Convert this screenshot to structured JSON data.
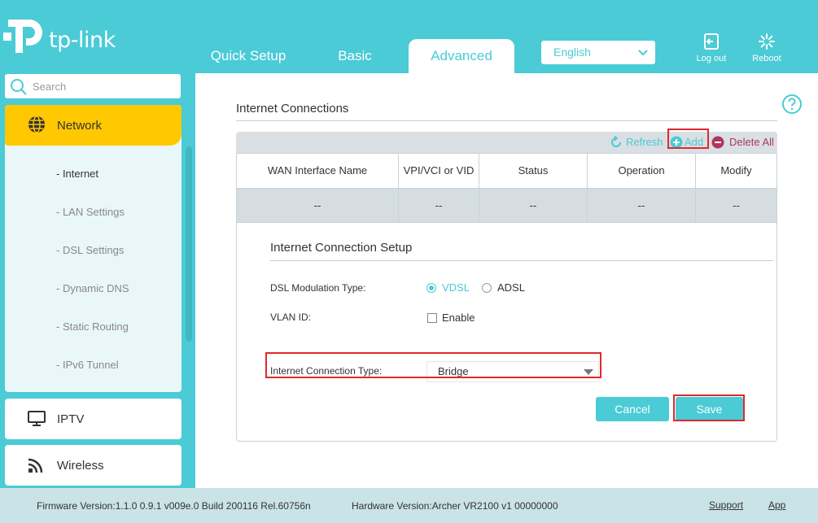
{
  "header": {
    "logo_text": "tp-link",
    "tabs": [
      {
        "label": "Quick Setup",
        "active": false
      },
      {
        "label": "Basic",
        "active": false
      },
      {
        "label": "Advanced",
        "active": true
      }
    ],
    "language": "English",
    "logout_label": "Log out",
    "reboot_label": "Reboot"
  },
  "sidebar": {
    "search_placeholder": "Search",
    "active_menu": {
      "label": "Network",
      "icon": "globe-icon"
    },
    "submenu": [
      {
        "label": "- Internet",
        "active": true
      },
      {
        "label": "- LAN Settings",
        "active": false
      },
      {
        "label": "- DSL Settings",
        "active": false
      },
      {
        "label": "- Dynamic DNS",
        "active": false
      },
      {
        "label": "- Static Routing",
        "active": false
      },
      {
        "label": "- IPv6 Tunnel",
        "active": false
      }
    ],
    "menu_items": [
      {
        "label": "IPTV",
        "icon": "monitor-icon"
      },
      {
        "label": "Wireless",
        "icon": "wifi-icon"
      }
    ]
  },
  "main": {
    "section_title": "Internet Connections",
    "toolbar": {
      "refresh": "Refresh",
      "add": "Add",
      "delete_all": "Delete All"
    },
    "table": {
      "headers": [
        "WAN Interface Name",
        "VPI/VCI or VID",
        "Status",
        "Operation",
        "Modify"
      ],
      "rows": [
        [
          "--",
          "--",
          "--",
          "--",
          "--"
        ]
      ]
    },
    "setup": {
      "title": "Internet Connection Setup",
      "dsl_label": "DSL Modulation Type:",
      "dsl_options": [
        "VDSL",
        "ADSL"
      ],
      "dsl_selected": "VDSL",
      "vlan_label": "VLAN ID:",
      "vlan_enable": "Enable",
      "vlan_checked": false,
      "conn_type_label": "Internet Connection Type:",
      "conn_type_value": "Bridge",
      "cancel": "Cancel",
      "save": "Save"
    }
  },
  "footer": {
    "firmware": "Firmware Version:1.1.0 0.9.1 v009e.0 Build 200116 Rel.60756n",
    "hardware": "Hardware Version:Archer VR2100 v1 00000000",
    "support": "Support",
    "app": "App"
  },
  "colors": {
    "accent": "#4acbd6",
    "active_menu": "#ffc800",
    "highlight_box": "#e0282f",
    "delete": "#b0365c"
  }
}
